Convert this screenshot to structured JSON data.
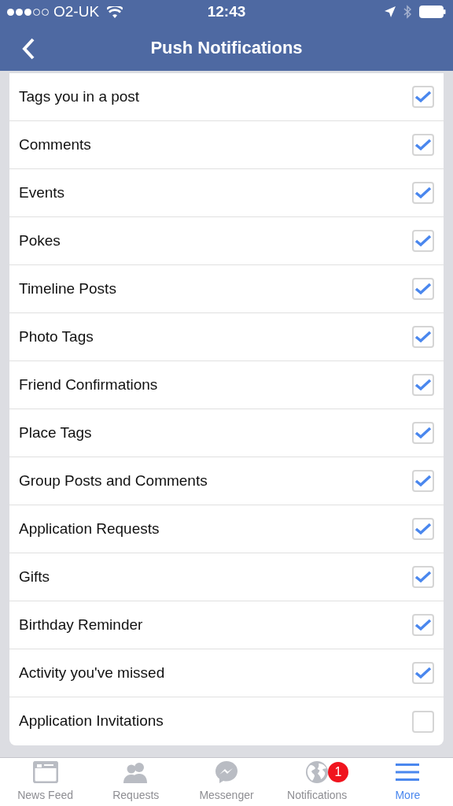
{
  "status_bar": {
    "signal_dots": [
      {
        "filled": true
      },
      {
        "filled": true
      },
      {
        "filled": true
      },
      {
        "filled": false
      },
      {
        "filled": false
      }
    ],
    "carrier": "O2-UK",
    "time": "12:43"
  },
  "nav": {
    "title": "Push Notifications"
  },
  "settings": [
    {
      "label": "Tags you in a post",
      "checked": true
    },
    {
      "label": "Comments",
      "checked": true
    },
    {
      "label": "Events",
      "checked": true
    },
    {
      "label": "Pokes",
      "checked": true
    },
    {
      "label": "Timeline Posts",
      "checked": true
    },
    {
      "label": "Photo Tags",
      "checked": true
    },
    {
      "label": "Friend Confirmations",
      "checked": true
    },
    {
      "label": "Place Tags",
      "checked": true
    },
    {
      "label": "Group Posts and Comments",
      "checked": true
    },
    {
      "label": "Application Requests",
      "checked": true
    },
    {
      "label": "Gifts",
      "checked": true
    },
    {
      "label": "Birthday Reminder",
      "checked": true
    },
    {
      "label": "Activity you've missed",
      "checked": true
    },
    {
      "label": "Application Invitations",
      "checked": false
    }
  ],
  "tab_bar": [
    {
      "kind": "feed",
      "label": "News Feed",
      "selected": false
    },
    {
      "kind": "requests",
      "label": "Requests",
      "selected": false
    },
    {
      "kind": "messenger",
      "label": "Messenger",
      "selected": false
    },
    {
      "kind": "notifications",
      "label": "Notifications",
      "selected": false,
      "badge": "1"
    },
    {
      "kind": "more",
      "label": "More",
      "selected": true
    }
  ]
}
